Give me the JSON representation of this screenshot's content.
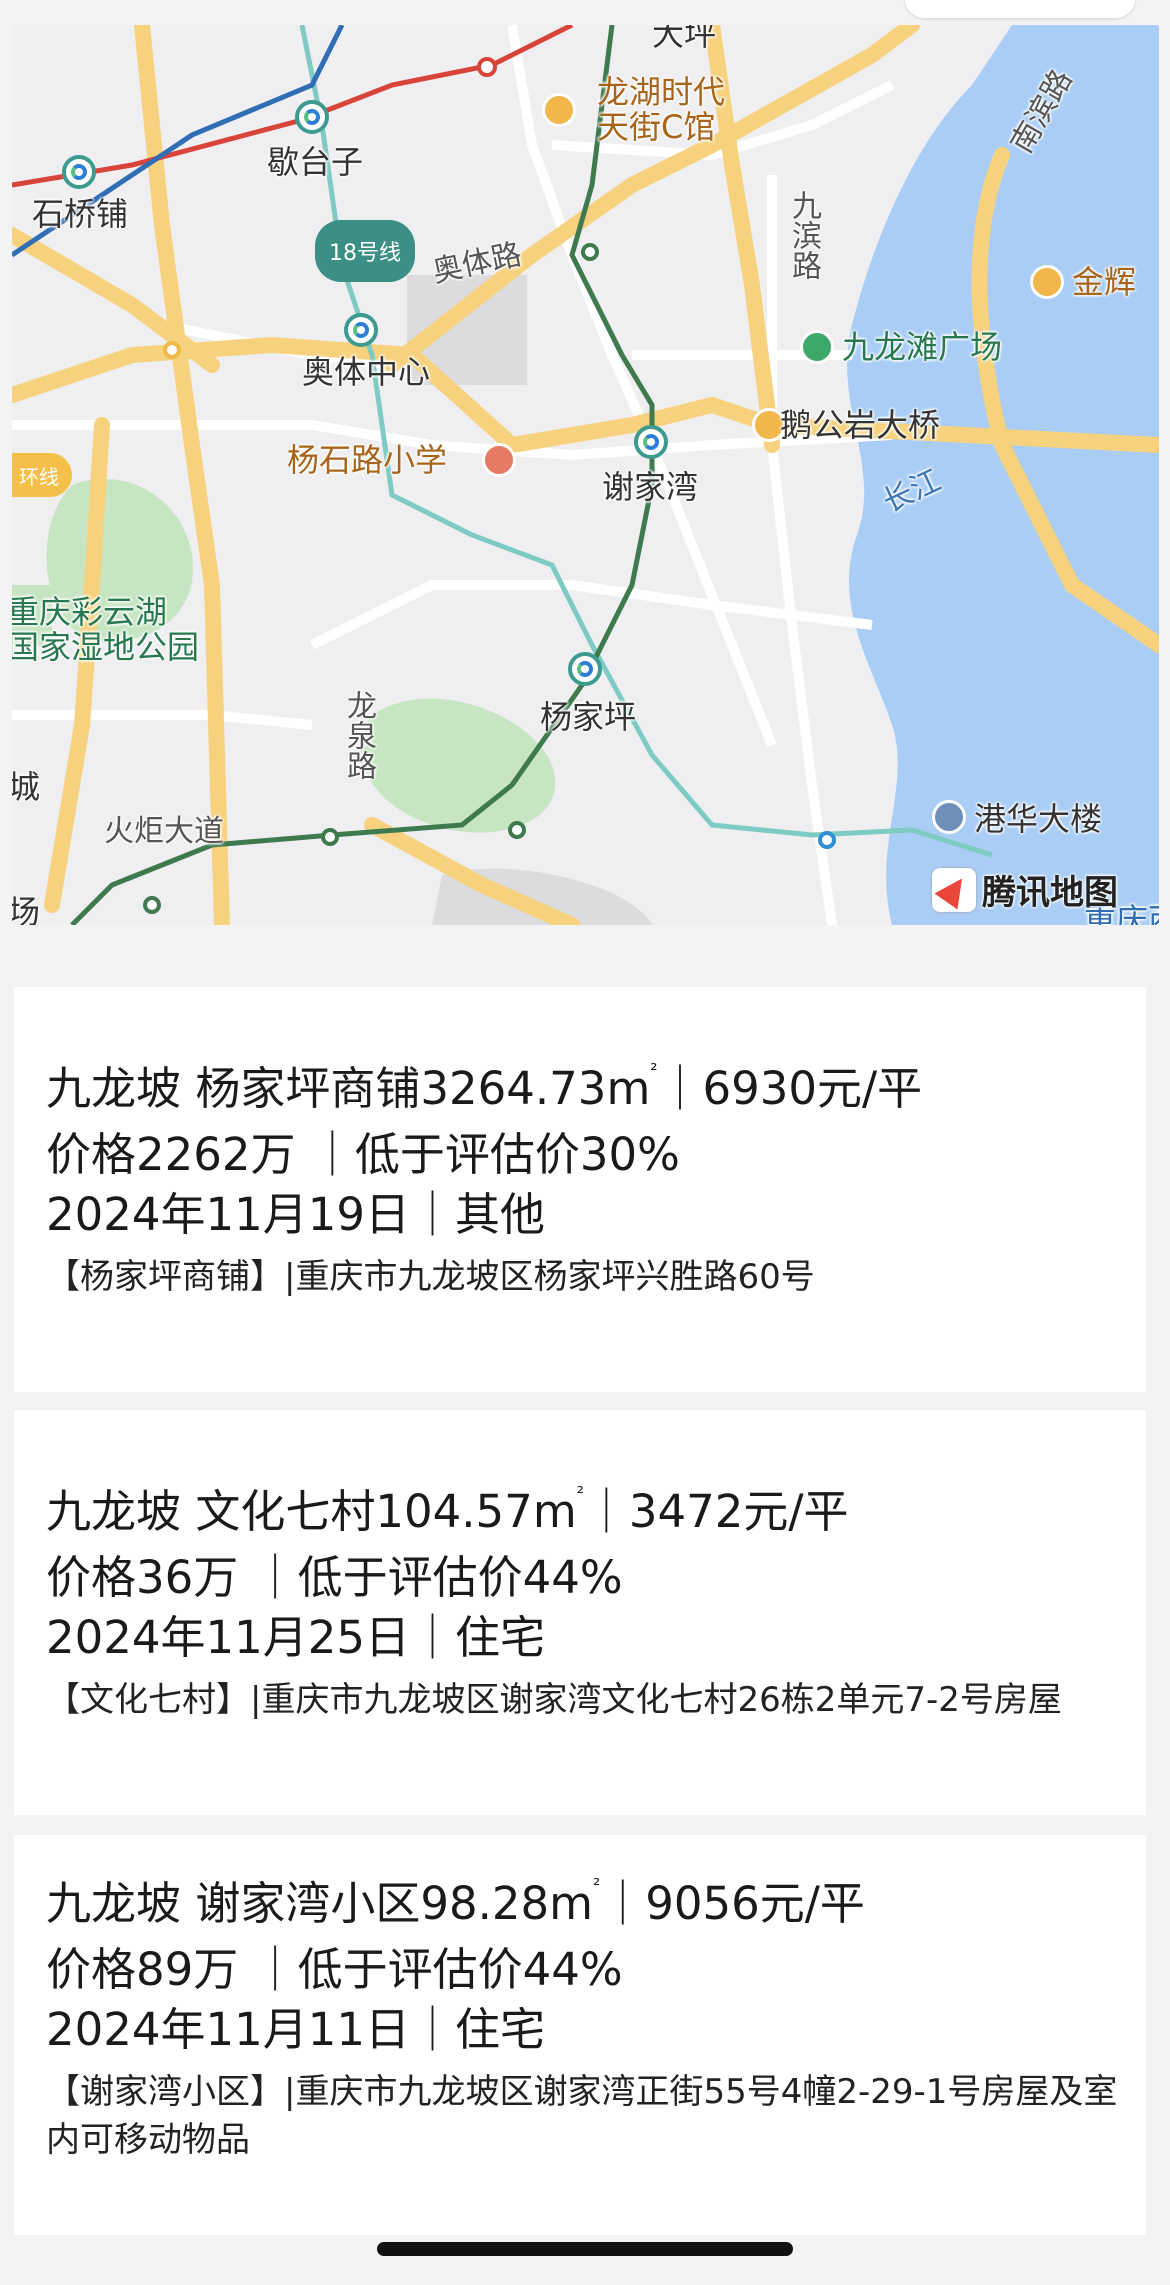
{
  "map": {
    "labels": {
      "datan": "大坪",
      "longhu": "龙湖时代\n天街C馆",
      "xietaizi": "歇台子",
      "shiqiaopu": "石桥铺",
      "line18": "18号线",
      "aotilu": "奥体路",
      "jiubinlu": "九滨路",
      "nanbinlu": "南滨路",
      "jinhui": "金辉",
      "jiulongtan": "九龙滩广场",
      "aoti": "奥体中心",
      "huanxian": "环线",
      "yangshilu": "杨石路小学",
      "xiejiawan": "谢家湾",
      "egongyan": "鹅公岩大桥",
      "changjiang": "长江",
      "caiyunhu": "重庆彩云湖\n国家湿地公园",
      "longquanlu": "龙泉路",
      "yangjiaping": "杨家坪",
      "huojudadao": "火炬大道",
      "ganghua": "港华大楼",
      "chang": "场",
      "cheng": "城",
      "chongqing": "重庆西"
    },
    "logo": "腾讯地图",
    "colors": {
      "water": "#a9cdf5",
      "green": "#c7e5c3",
      "highway": "#f7d27e",
      "metro_green": "#3f7a4f",
      "metro_teal": "#7ecbc3",
      "metro_red": "#d9443a",
      "metro_blue": "#2f6db5"
    }
  },
  "listings": [
    {
      "district": "九龙坡",
      "name": "杨家坪商铺",
      "area": "3264.73",
      "unit": "m",
      "sup": "²",
      "unit_price": "｜6930元/平",
      "price_line": "价格2262万 ｜低于评估价30%",
      "date_line": "2024年11月19日｜其他",
      "address": "【杨家坪商铺】|重庆市九龙坡区杨家坪兴胜路60号"
    },
    {
      "district": "九龙坡",
      "name": "文化七村",
      "area": "104.57",
      "unit": "m",
      "sup": "²",
      "unit_price": "｜3472元/平",
      "price_line": "价格36万 ｜低于评估价44%",
      "date_line": "2024年11月25日｜住宅",
      "address": "【文化七村】|重庆市九龙坡区谢家湾文化七村26栋2单元7-2号房屋"
    },
    {
      "district": "九龙坡",
      "name": "谢家湾小区",
      "area": "98.28",
      "unit": "m",
      "sup": "²",
      "unit_price": "｜9056元/平",
      "price_line": "价格89万 ｜低于评估价44%",
      "date_line": "2024年11月11日｜住宅",
      "address": "【谢家湾小区】|重庆市九龙坡区谢家湾正街55号4幢2-29-1号房屋及室内可移动物品"
    }
  ]
}
